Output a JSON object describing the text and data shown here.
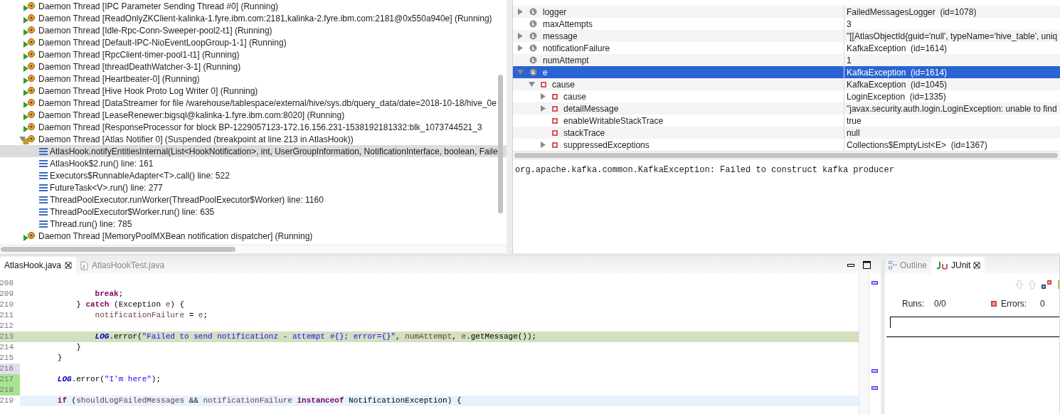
{
  "debug_tree": {
    "threads": [
      {
        "label": "Daemon Thread [IPC Parameter Sending Thread #0] (Running)",
        "kind": "running",
        "expanded": false
      },
      {
        "label": "Daemon Thread [ReadOnlyZKClient-kalinka-1.fyre.ibm.com:2181,kalinka-2.fyre.ibm.com:2181@0x550a940e] (Running)",
        "kind": "running",
        "expanded": false
      },
      {
        "label": "Daemon Thread [Idle-Rpc-Conn-Sweeper-pool2-t1] (Running)",
        "kind": "running",
        "expanded": false
      },
      {
        "label": "Daemon Thread [Default-IPC-NioEventLoopGroup-1-1] (Running)",
        "kind": "running",
        "expanded": false
      },
      {
        "label": "Daemon Thread [RpcClient-timer-pool1-t1] (Running)",
        "kind": "running",
        "expanded": false
      },
      {
        "label": "Daemon Thread [threadDeathWatcher-3-1] (Running)",
        "kind": "running",
        "expanded": false
      },
      {
        "label": "Daemon Thread [Heartbeater-0] (Running)",
        "kind": "running",
        "expanded": false
      },
      {
        "label": "Daemon Thread [Hive Hook Proto Log Writer 0] (Running)",
        "kind": "running",
        "expanded": false
      },
      {
        "label": "Daemon Thread [DataStreamer for file /warehouse/tablespace/external/hive/sys.db/query_data/date=2018-10-18/hive_0e",
        "kind": "running",
        "expanded": false
      },
      {
        "label": "Daemon Thread [LeaseRenewer:bigsql@kalinka-1.fyre.ibm.com:8020] (Running)",
        "kind": "running",
        "expanded": false
      },
      {
        "label": "Daemon Thread [ResponseProcessor for block BP-1229057123-172.16.156.231-1538192181332:blk_1073744521_3",
        "kind": "running",
        "expanded": false
      },
      {
        "label": "Daemon Thread [Atlas Notifier 0] (Suspended (breakpoint at line 213 in AtlasHook))",
        "kind": "suspended",
        "expanded": true,
        "children": [
          {
            "label": "AtlasHook.notifyEntitiesInternal(List<HookNotification>, int, UserGroupInformation, NotificationInterface, boolean, Faile",
            "selected": true
          },
          {
            "label": "AtlasHook$2.run() line: 161",
            "selected": false
          },
          {
            "label": "Executors$RunnableAdapter<T>.call() line: 522",
            "selected": false
          },
          {
            "label": "FutureTask<V>.run() line: 277",
            "selected": false
          },
          {
            "label": "ThreadPoolExecutor.runWorker(ThreadPoolExecutor$Worker) line: 1160",
            "selected": false
          },
          {
            "label": "ThreadPoolExecutor$Worker.run() line: 635",
            "selected": false
          },
          {
            "label": "Thread.run() line: 785",
            "selected": false
          }
        ]
      },
      {
        "label": "Daemon Thread [MemoryPoolMXBean notification dispatcher] (Running)",
        "kind": "running",
        "expanded": false
      }
    ]
  },
  "variables": {
    "rows": [
      {
        "name": "logger",
        "value": "FailedMessagesLogger  (id=1078)",
        "kind": "local",
        "expandable": true,
        "expanded": false,
        "selected": false
      },
      {
        "name": "maxAttempts",
        "value": "3",
        "kind": "local",
        "expandable": false,
        "selected": false
      },
      {
        "name": "message",
        "value": "\"[[AtlasObjectId{guid='null', typeName='hive_table', uniq",
        "kind": "local",
        "expandable": true,
        "expanded": false,
        "selected": false
      },
      {
        "name": "notificationFailure",
        "value": "KafkaException  (id=1614)",
        "kind": "local",
        "expandable": true,
        "expanded": false,
        "selected": false
      },
      {
        "name": "numAttempt",
        "value": "1",
        "kind": "local",
        "expandable": false,
        "selected": false
      },
      {
        "name": "e",
        "value": "KafkaException  (id=1614)",
        "kind": "local",
        "expandable": true,
        "expanded": true,
        "selected": true,
        "children": [
          {
            "name": "cause",
            "value": "KafkaException  (id=1045)",
            "kind": "field",
            "expandable": true,
            "expanded": true,
            "selected": false,
            "children": [
              {
                "name": "cause",
                "value": "LoginException  (id=1335)",
                "kind": "field",
                "expandable": true,
                "expanded": false,
                "selected": false
              },
              {
                "name": "detailMessage",
                "value": "\"javax.security.auth.login.LoginException: unable to find",
                "kind": "field",
                "expandable": true,
                "expanded": false,
                "selected": false
              },
              {
                "name": "enableWritableStackTrace",
                "value": "true",
                "kind": "field",
                "expandable": false,
                "selected": false
              },
              {
                "name": "stackTrace",
                "value": "null",
                "kind": "field",
                "expandable": false,
                "selected": false
              },
              {
                "name": "suppressedExceptions",
                "value": "Collections$EmptyList<E>  (id=1367)",
                "kind": "field",
                "expandable": true,
                "expanded": false,
                "selected": false
              }
            ]
          }
        ]
      }
    ],
    "detail": "org.apache.kafka.common.KafkaException: Failed to construct kafka producer"
  },
  "editor": {
    "tabs": [
      {
        "label": "AtlasHook.java",
        "selected": true
      },
      {
        "label": "AtlasHookTest.java",
        "selected": false
      }
    ],
    "lines": [
      {
        "number": "208",
        "executing": false,
        "caret": false,
        "changed": false,
        "added": false
      },
      {
        "number": "209",
        "executing": false,
        "caret": false,
        "changed": false,
        "added": false,
        "tokens": [
          {
            "text": "                break",
            "kind": "keyword"
          },
          {
            "text": ";",
            "kind": "plain"
          }
        ]
      },
      {
        "number": "210",
        "executing": false,
        "caret": false,
        "changed": false,
        "added": false,
        "tokens": [
          {
            "text": "            } ",
            "kind": "plain"
          },
          {
            "text": "catch",
            "kind": "keyword"
          },
          {
            "text": " (Exception ",
            "kind": "plain"
          },
          {
            "text": "e",
            "kind": "local"
          },
          {
            "text": ") {",
            "kind": "plain"
          }
        ]
      },
      {
        "number": "211",
        "executing": false,
        "caret": false,
        "changed": false,
        "added": false,
        "tokens": [
          {
            "text": "                notificationFailure",
            "kind": "local"
          },
          {
            "text": " = ",
            "kind": "plain"
          },
          {
            "text": "e",
            "kind": "local"
          },
          {
            "text": ";",
            "kind": "plain"
          }
        ]
      },
      {
        "number": "212",
        "executing": false,
        "caret": false,
        "changed": false,
        "added": false
      },
      {
        "number": "213",
        "executing": true,
        "caret": false,
        "changed": false,
        "added": false,
        "tokens": [
          {
            "text": "                LOG",
            "kind": "static"
          },
          {
            "text": ".error(",
            "kind": "plain"
          },
          {
            "text": "\"Failed to send notificationz - attempt #{}; error={}\"",
            "kind": "string"
          },
          {
            "text": ", ",
            "kind": "plain"
          },
          {
            "text": "numAttempt",
            "kind": "local"
          },
          {
            "text": ", ",
            "kind": "plain"
          },
          {
            "text": "e",
            "kind": "local"
          },
          {
            "text": ".getMessage());",
            "kind": "plain"
          }
        ]
      },
      {
        "number": "214",
        "executing": false,
        "caret": false,
        "changed": false,
        "added": false,
        "tokens": [
          {
            "text": "            }",
            "kind": "plain"
          }
        ]
      },
      {
        "number": "215",
        "executing": false,
        "caret": false,
        "changed": false,
        "added": false,
        "tokens": [
          {
            "text": "        }",
            "kind": "plain"
          }
        ]
      },
      {
        "number": "216",
        "executing": false,
        "caret": false,
        "changed": true,
        "added": false
      },
      {
        "number": "217",
        "executing": false,
        "caret": false,
        "changed": false,
        "added": true,
        "tokens": [
          {
            "text": "        LOG",
            "kind": "static"
          },
          {
            "text": ".error(",
            "kind": "plain"
          },
          {
            "text": "\"I'm here\"",
            "kind": "string"
          },
          {
            "text": ");",
            "kind": "plain"
          }
        ]
      },
      {
        "number": "218",
        "executing": false,
        "caret": false,
        "changed": false,
        "added": true
      },
      {
        "number": "219",
        "executing": false,
        "caret": true,
        "changed": false,
        "added": false,
        "tokens": [
          {
            "text": "        if",
            "kind": "keyword"
          },
          {
            "text": " (",
            "kind": "plain"
          },
          {
            "text": "shouldLogFailedMessages",
            "kind": "local"
          },
          {
            "text": " && ",
            "kind": "plain"
          },
          {
            "text": "notificationFailure",
            "kind": "local"
          },
          {
            "text": " instanceof",
            "kind": "keyword"
          },
          {
            "text": " NotificationException) {",
            "kind": "plain"
          }
        ]
      }
    ]
  },
  "junit": {
    "tabs": [
      {
        "label": "Outline",
        "selected": false
      },
      {
        "label": "JUnit",
        "selected": true
      }
    ],
    "progress": {
      "level": 0
    },
    "runs_label": "Runs:",
    "runs": "0/0",
    "errors_label": "Errors:",
    "errors": "0"
  }
}
